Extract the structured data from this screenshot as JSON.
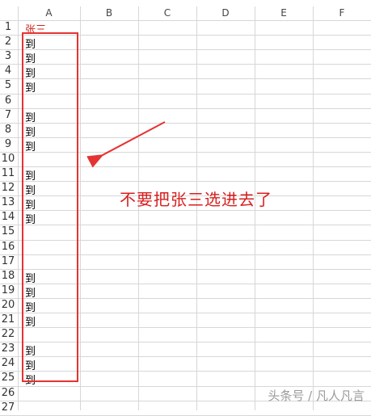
{
  "columns": [
    "A",
    "B",
    "C",
    "D",
    "E",
    "F"
  ],
  "rows": [
    {
      "num": "1",
      "a": "张三"
    },
    {
      "num": "2",
      "a": "到"
    },
    {
      "num": "3",
      "a": "到"
    },
    {
      "num": "4",
      "a": "到"
    },
    {
      "num": "5",
      "a": "到"
    },
    {
      "num": "6",
      "a": ""
    },
    {
      "num": "7",
      "a": "到"
    },
    {
      "num": "8",
      "a": "到"
    },
    {
      "num": "9",
      "a": "到"
    },
    {
      "num": "10",
      "a": ""
    },
    {
      "num": "11",
      "a": "到"
    },
    {
      "num": "12",
      "a": "到"
    },
    {
      "num": "13",
      "a": "到"
    },
    {
      "num": "14",
      "a": "到"
    },
    {
      "num": "15",
      "a": ""
    },
    {
      "num": "16",
      "a": ""
    },
    {
      "num": "17",
      "a": ""
    },
    {
      "num": "18",
      "a": "到"
    },
    {
      "num": "19",
      "a": "到"
    },
    {
      "num": "20",
      "a": "到"
    },
    {
      "num": "21",
      "a": "到"
    },
    {
      "num": "22",
      "a": ""
    },
    {
      "num": "23",
      "a": "到"
    },
    {
      "num": "24",
      "a": "到"
    },
    {
      "num": "25",
      "a": "到"
    },
    {
      "num": "26",
      "a": ""
    },
    {
      "num": "27",
      "a": ""
    }
  ],
  "annotation": {
    "text": "不要把张三选进去了",
    "color": "#d81e1e"
  },
  "watermark": "头条号 / 凡人凡言",
  "colors": {
    "selection_border": "#e53333",
    "header_cell_text": "#d02020",
    "gridline": "#d7d7d7"
  }
}
